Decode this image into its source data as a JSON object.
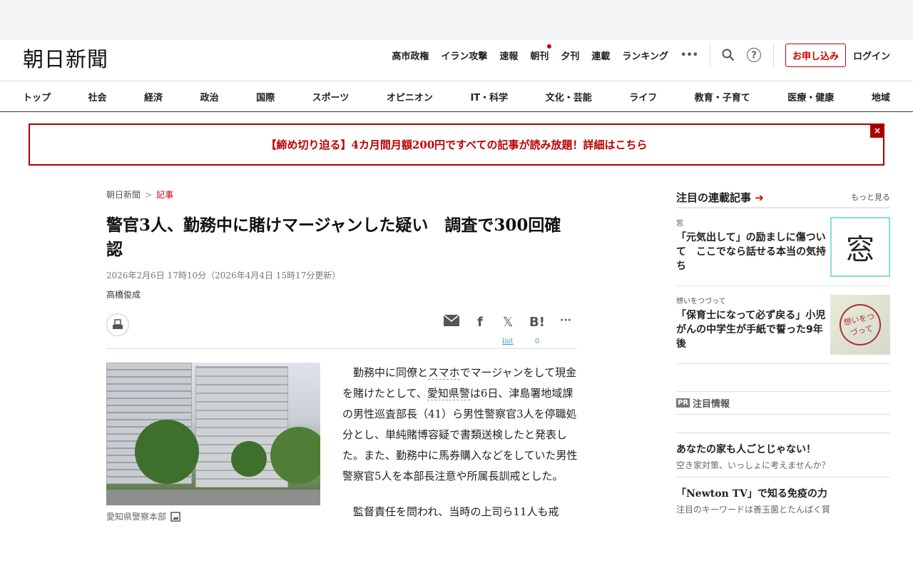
{
  "header": {
    "logo": "朝日新聞",
    "topnav": [
      "高市政権",
      "イラン攻撃",
      "速報",
      "朝刊",
      "夕刊",
      "連載",
      "ランキング"
    ],
    "more": "•••",
    "apply": "お申し込み",
    "login": "ログイン"
  },
  "categories": [
    "トップ",
    "社会",
    "経済",
    "政治",
    "国際",
    "スポーツ",
    "オピニオン",
    "IT・科学",
    "文化・芸能",
    "ライフ",
    "教育・子育て",
    "医療・健康",
    "地域"
  ],
  "banner": {
    "text": "【締め切り迫る】4カ月間月額200円ですべての記事が読み放題！詳細はこちら",
    "close": "×"
  },
  "article": {
    "breadcrumb": [
      "朝日新聞",
      "記事"
    ],
    "breadcrumb_sep": ">",
    "title": "警官3人、勤務中に賭けマージャンした疑い　調査で300回確認",
    "date": "2026年2月6日 17時10分（2026年4月4日 15時17分更新）",
    "author": "高橋俊成",
    "share": {
      "x_count": "list",
      "hatena_count": "0"
    },
    "caption": "愛知県警察本部",
    "paragraphs": [
      [
        "勤務中に同僚と",
        "スマホ",
        "でマージャンをして現金を賭けたとして、",
        "愛知県警",
        "は6日、津島署地域課の男性巡査部長（41）ら男性警察官3人を停職処分とし、単純賭博容疑で書類送検したと発表した。また、勤務中に馬券購入などをしていた男性警察官5人を本部長注意や所属長訓戒とした。"
      ],
      [
        "監督責任を問われ、当時の上司ら11人も戒"
      ]
    ]
  },
  "sidebar": {
    "heading": "注目の連載記事",
    "more": "もっと見る",
    "items": [
      {
        "category": "窓",
        "title": "「元気出して」の励ましに傷ついて　ここでなら話せる本当の気持ち",
        "thumb": "窓"
      },
      {
        "category": "想いをつづって",
        "title": "「保育士になって必ず戻る」小児がんの中学生が手紙で誓った9年後",
        "thumb": "想いをつづって"
      }
    ],
    "pr_badge": "PR",
    "pr_heading": "注目情報",
    "pr_items": [
      {
        "title": "あなたの家も人ごとじゃない！",
        "sub": "空き家対策、いっしょに考えませんか？"
      },
      {
        "title": "「Newton TV」で知る免疫の力",
        "sub": "注目のキーワードは善玉菌とたんぱく質"
      }
    ]
  }
}
